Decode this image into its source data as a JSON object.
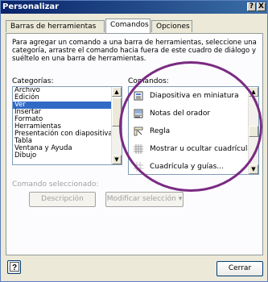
{
  "window": {
    "title": "Personalizar",
    "help_btn": "?",
    "close_btn": "X"
  },
  "tabs": [
    {
      "label": "Barras de herramientas",
      "active": false
    },
    {
      "label": "Comandos",
      "active": true
    },
    {
      "label": "Opciones",
      "active": false
    }
  ],
  "description": "Para agregar un comando a una barra de herramientas, seleccione una categoría, arrastre el comando hacia fuera de este cuadro de diálogo y suéltelo en una barra de herramientas.",
  "categories": {
    "label": "Categorías:",
    "items": [
      "Archivo",
      "Edición",
      "Ver",
      "Insertar",
      "Formato",
      "Herramientas",
      "Presentación con diapositivas",
      "Tabla",
      "Ventana y Ayuda",
      "Dibujo"
    ],
    "selected": "Ver"
  },
  "commands": {
    "label": "Comandos:",
    "items": [
      {
        "label": "Diapositiva en miniatura",
        "icon": "slide-thumbnail-icon"
      },
      {
        "label": "Notas del orador",
        "icon": "speaker-notes-icon"
      },
      {
        "label": "Regla",
        "icon": "ruler-icon"
      },
      {
        "label": "Mostrar u ocultar cuadrícula",
        "icon": "grid-icon"
      },
      {
        "label": "Cuadrícula y guías...",
        "icon": "grid-guides-icon"
      }
    ]
  },
  "selected_command": {
    "label": "Comando seleccionado:",
    "description_btn": "Descripción",
    "modify_btn": "Modificar selección ▾"
  },
  "footer": {
    "help_icon": "help-icon",
    "close_btn": "Cerrar"
  },
  "background": {
    "text_s": "s",
    "text_y": "y"
  },
  "colors": {
    "highlight_circle": "#7a2a82",
    "selection": "#316ac5",
    "titlebar": "#0a246a"
  }
}
